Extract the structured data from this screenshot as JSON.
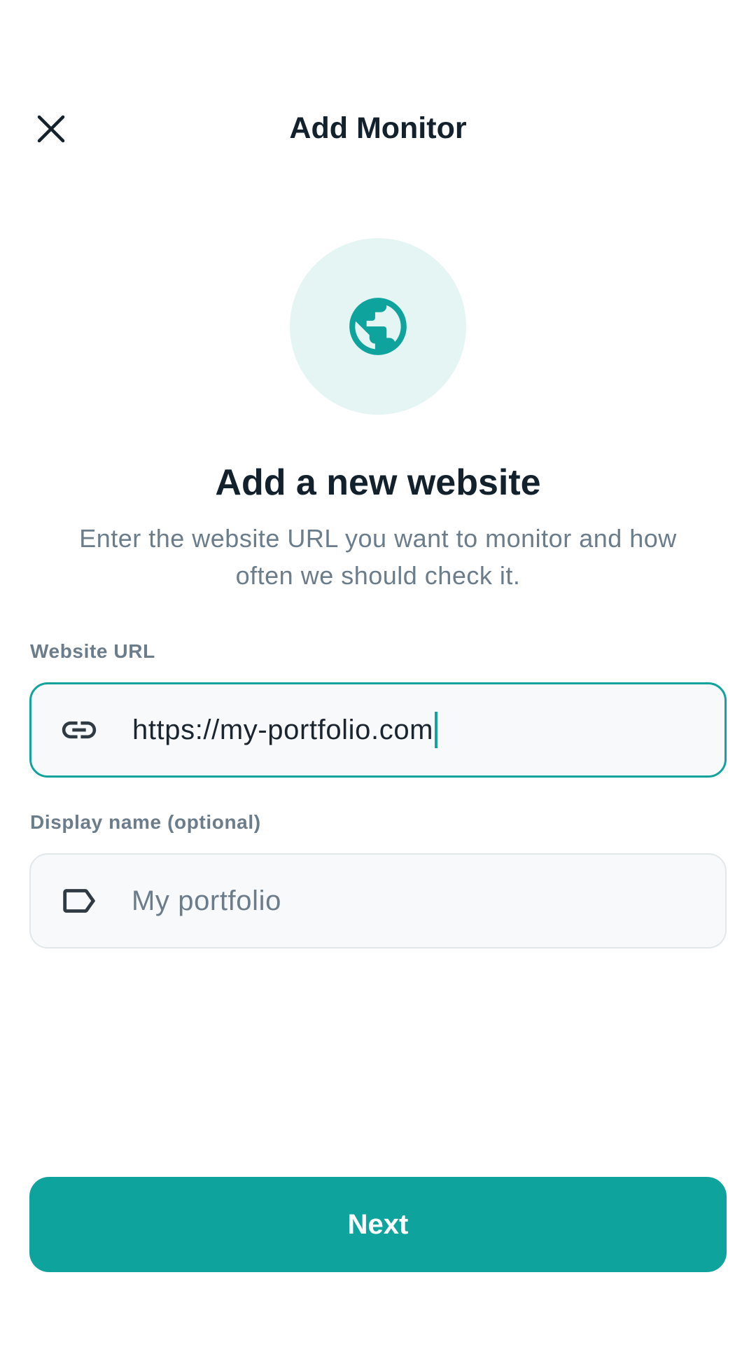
{
  "header": {
    "title": "Add Monitor",
    "close_icon": "close-icon"
  },
  "hero": {
    "icon": "globe-icon",
    "title": "Add a new website",
    "subtitle_line1": "Enter the website URL you want to monitor and how",
    "subtitle_line2": "often we should check it."
  },
  "form": {
    "url": {
      "label": "Website URL",
      "icon": "link-icon",
      "value": "https://my-portfolio.com"
    },
    "name": {
      "label": "Display name (optional)",
      "icon": "tag-icon",
      "placeholder": "My portfolio"
    }
  },
  "actions": {
    "next_label": "Next"
  },
  "colors": {
    "accent": "#0fa39d",
    "accent_soft": "#e5f5f3",
    "text_dark": "#13212c",
    "text_muted": "#6b7c8b"
  }
}
